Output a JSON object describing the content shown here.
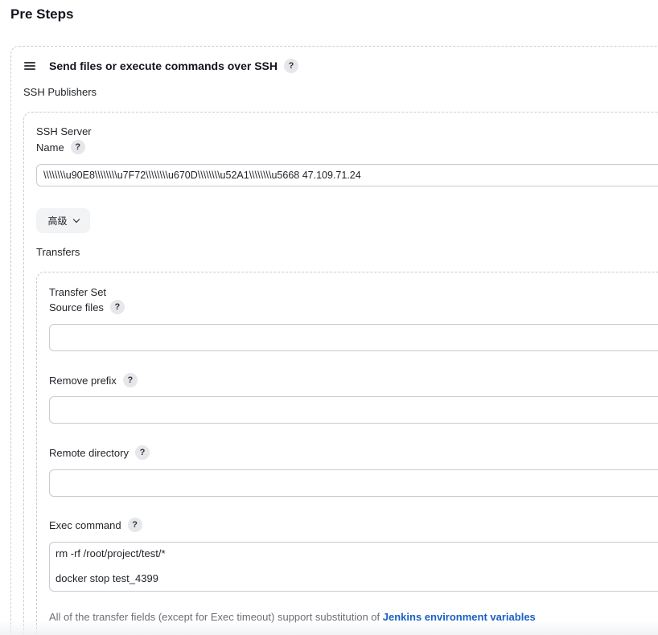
{
  "section": {
    "title": "Pre Steps"
  },
  "step": {
    "title": "Send files or execute commands over SSH",
    "help": "?"
  },
  "ssh_publishers": {
    "label": "SSH Publishers"
  },
  "ssh_server": {
    "label": "SSH Server",
    "name_label": "Name",
    "name_value": "\\\\\\\\\\\\\\\\u90E8\\\\\\\\\\\\\\\\u7F72\\\\\\\\\\\\\\\\u670D\\\\\\\\\\\\\\\\u52A1\\\\\\\\\\\\\\\\u5668 47.109.71.24",
    "advanced_label": "高级"
  },
  "transfers": {
    "label": "Transfers"
  },
  "transfer_set": {
    "label": "Transfer Set",
    "source_files_label": "Source files",
    "source_files_value": "",
    "remove_prefix_label": "Remove prefix",
    "remove_prefix_value": "",
    "remote_directory_label": "Remote directory",
    "remote_directory_value": "",
    "exec_command_label": "Exec command",
    "exec_command_lines": [
      "rm -rf /root/project/test/*",
      "docker stop test_4399"
    ]
  },
  "note": {
    "text": "All of the transfer fields (except for Exec timeout) support substitution of",
    "link": "Jenkins environment variables"
  }
}
